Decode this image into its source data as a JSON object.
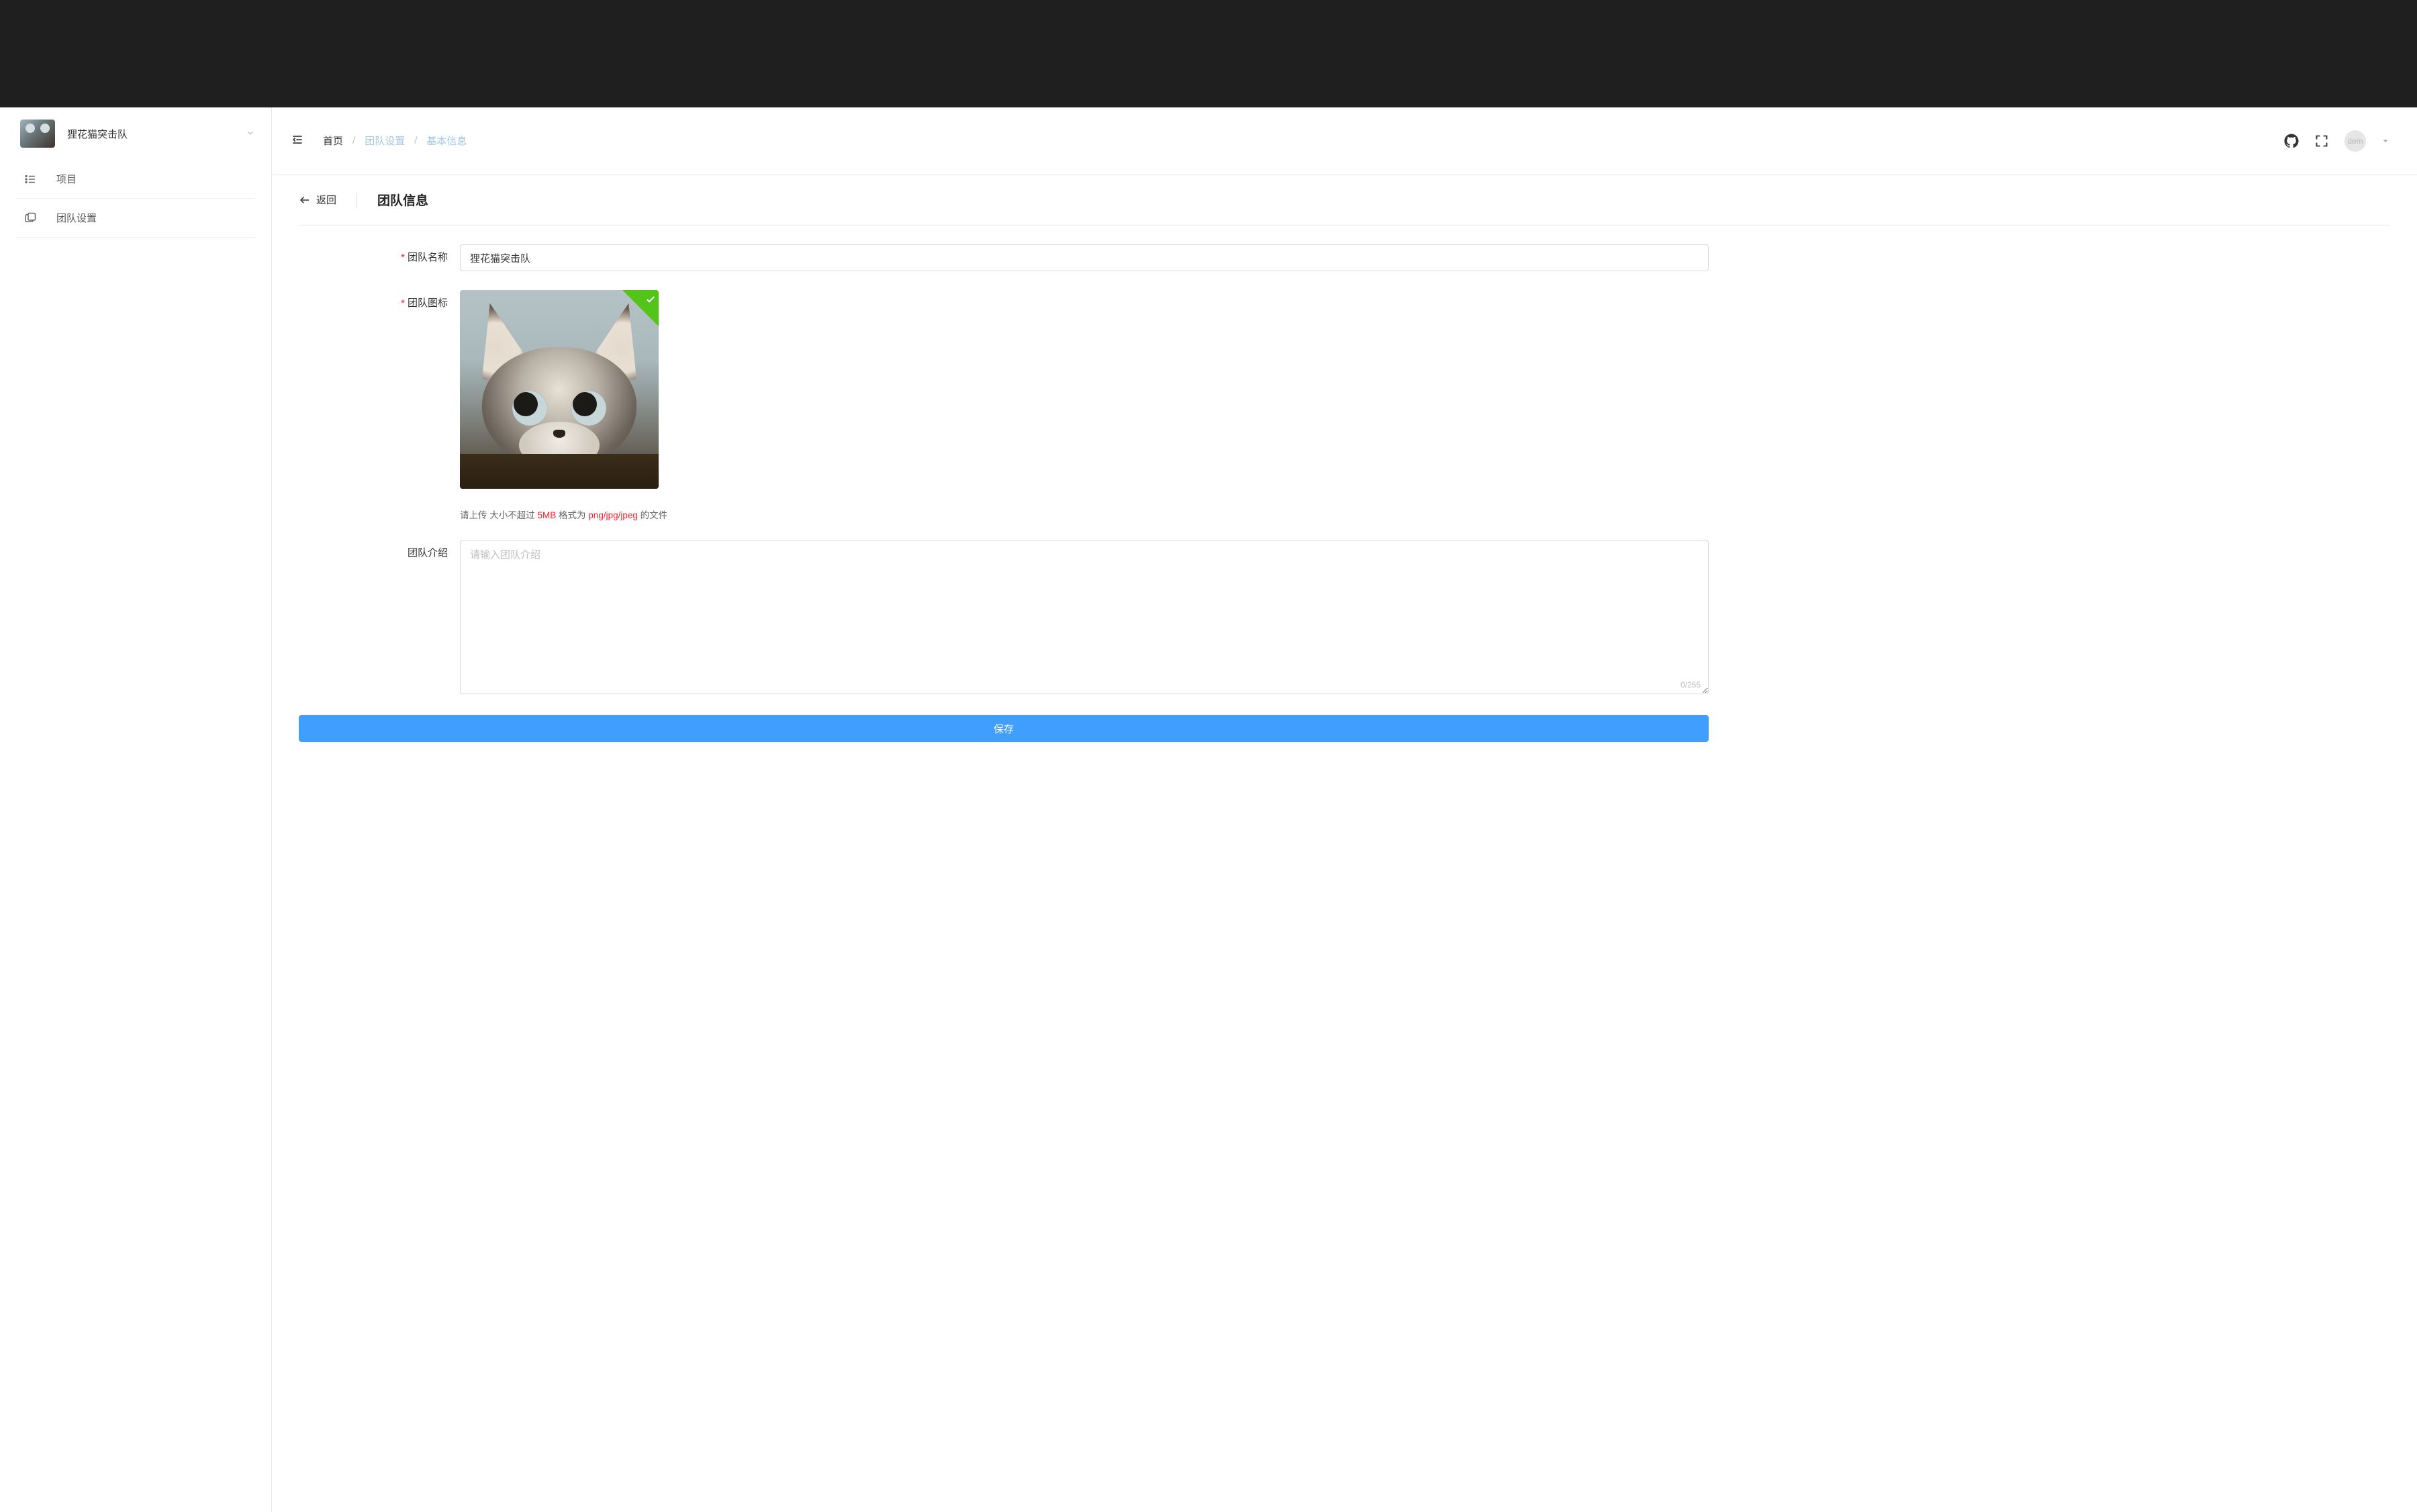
{
  "sidebar": {
    "team_name": "狸花猫突击队",
    "items": [
      {
        "label": "项目"
      },
      {
        "label": "团队设置"
      }
    ]
  },
  "topbar": {
    "breadcrumb": {
      "home": "首页",
      "team_settings": "团队设置",
      "basic_info": "基本信息"
    },
    "user_label": "dem"
  },
  "page": {
    "back_label": "返回",
    "title": "团队信息"
  },
  "form": {
    "team_name_label": "团队名称",
    "team_name_value": "狸花猫突击队",
    "team_icon_label": "团队图标",
    "upload_hint_prefix": "请上传 大小不超过 ",
    "upload_hint_size": "5MB",
    "upload_hint_mid": " 格式为 ",
    "upload_hint_format": "png/jpg/jpeg",
    "upload_hint_suffix": " 的文件",
    "team_intro_label": "团队介绍",
    "team_intro_placeholder": "请输入团队介绍",
    "char_counter": "0/255",
    "submit_label": "保存"
  }
}
